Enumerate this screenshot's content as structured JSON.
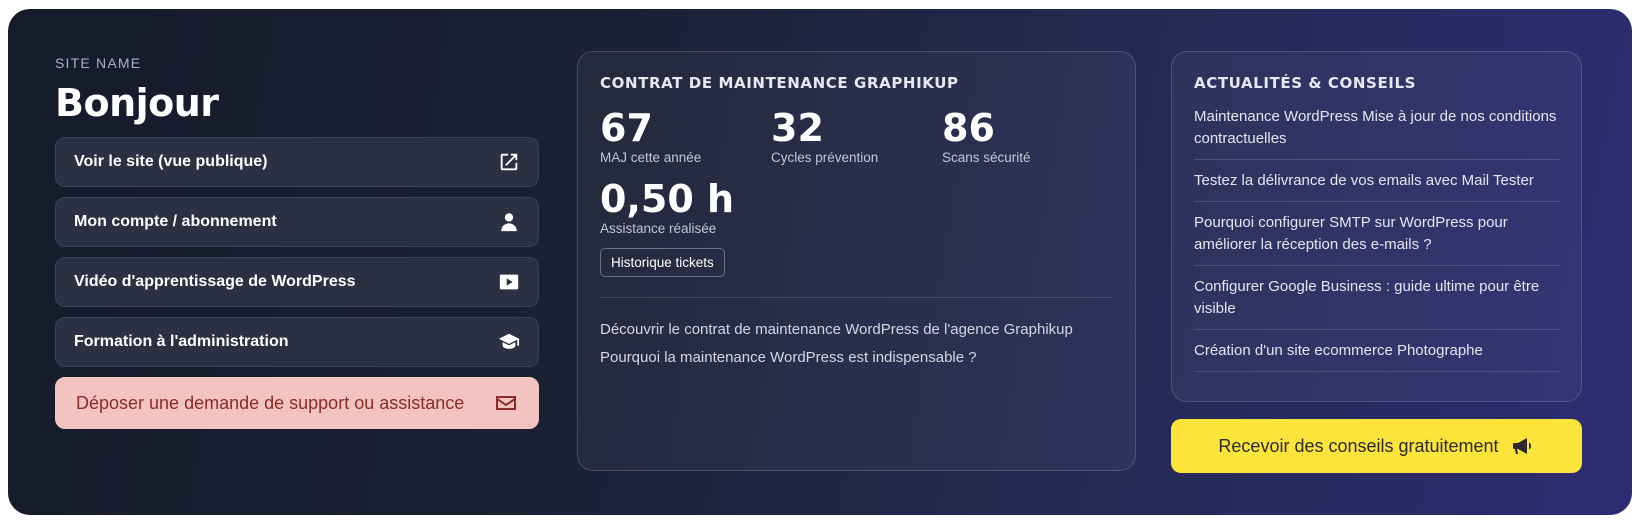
{
  "header": {
    "site_name": "SITE NAME",
    "greeting": "Bonjour"
  },
  "quick_links": [
    {
      "label": "Voir le site (vue publique)",
      "icon": "external-link-icon"
    },
    {
      "label": "Mon compte / abonnement",
      "icon": "user-icon"
    },
    {
      "label": "Vidéo d'apprentissage de WordPress",
      "icon": "video-play-icon"
    },
    {
      "label": "Formation à l'administration",
      "icon": "graduation-cap-icon"
    }
  ],
  "support": {
    "label": "Déposer une demande de support ou assistance",
    "icon": "envelope-icon"
  },
  "maintenance": {
    "title": "CONTRAT DE MAINTENANCE GRAPHIKUP",
    "stats": [
      {
        "value": "67",
        "label": "MAJ cette année"
      },
      {
        "value": "32",
        "label": "Cycles prévention"
      },
      {
        "value": "86",
        "label": "Scans sécurité"
      }
    ],
    "assistance": {
      "value": "0,50 h",
      "label": "Assistance réalisée"
    },
    "history_button": "Historique tickets",
    "links": [
      "Découvrir le contrat de maintenance WordPress de l'agence Graphikup",
      "Pourquoi la maintenance WordPress est indispensable ?"
    ]
  },
  "news": {
    "title": "ACTUALITÉS & CONSEILS",
    "items": [
      "Maintenance WordPress  Mise à jour de nos conditions contractuelles",
      "Testez la délivrance de vos emails avec Mail Tester",
      "Pourquoi configurer SMTP sur WordPress pour améliorer la réception des e-mails ?",
      "Configurer Google Business : guide ultime pour être visible",
      "Création d'un site ecommerce Photographe"
    ]
  },
  "cta": {
    "label": "Recevoir des conseils gratuitement",
    "icon": "megaphone-icon"
  },
  "colors": {
    "panel_dark": "#161b2b",
    "panel_indigo": "#2d2c73",
    "support_bg": "#f3c3c1",
    "support_text": "#8a2c28",
    "cta_bg": "#fde43a"
  }
}
